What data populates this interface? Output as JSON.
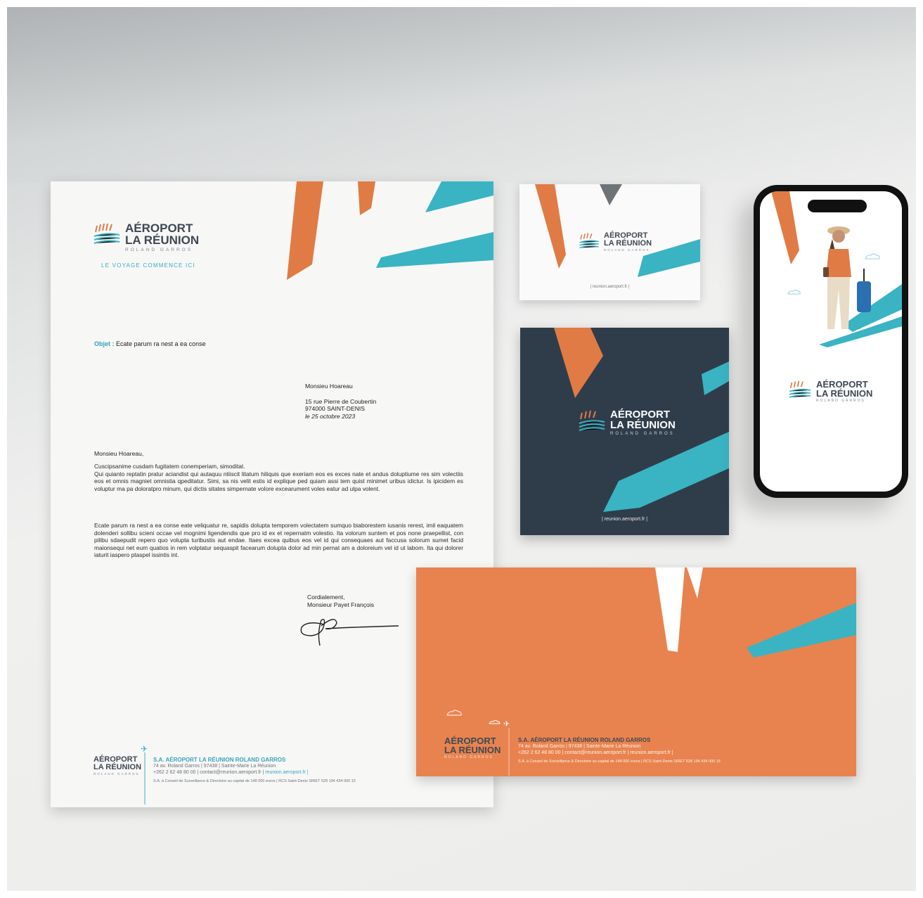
{
  "brand": {
    "line1": "AÉROPORT",
    "line2": "LA RÉUNION",
    "line3": "ROLAND GARROS",
    "tagline": "LE VOYAGE COMMENCE ICI",
    "website": "reunion.aeroport.fr",
    "colors": {
      "orange": "#e07b45",
      "teal": "#3ab3c3",
      "navy": "#2f3d4b",
      "grey": "#6e7378"
    }
  },
  "letter": {
    "objet_label": "Objet :",
    "objet_text": "Ecate parum ra nest a ea conse",
    "recipient_name": "Monsieu Hoareau",
    "address_line1": "15 rue Pierre de Coubertin",
    "address_line2": "974000 SAINT-DENIS",
    "date": "le 25 octobre 2023",
    "salutation": "Monsieu Hoareau,",
    "para1_first": "Cuscipsanime cusdam fugitatem conemperiam, simoditat.",
    "para1": "Qui quianto reptatin pratur aciandist qui autaquu ntiiscit litatum hiliquis que exeriam eos es exces nate et andus doluptiume res sim volectiis eos et omnis magniet omnistia qpeditatur. Simi, sa nis velit estis id explique ped quiam assi tem quist minimet uribus idictur. Is ipicidem es voluptur ma pa doloratpro minum, qui dictis sitates simpernate volore excearument voles eatur ad ulpa volent.",
    "para2": "Ecate parum ra nest a ea conse eate veliquatur re, sapidis dolupta temporem volectatem sumquo biaborestem iusanis rerest, imil eaquatem dolenderi sollibu scieni occae vel mognimi ligendendis que pro id ex et repernatm volestio. Ita volorum suntem et pos none praepellist, con pilibu sdaepudit repero quo volupta turibustis aut endae. Itaes excea quibus eos vel id qui consequaes aut faccusa solorum sumet facid maionsequi net eum quatios in rem volptatur sequaspit facearum dolupta dolor ad min pernat am a doloreium vel id ut labom. Ita qui dolorer iaturit iaspero ptaspel issintis int.",
    "closing": "Cordialement,",
    "signatory": "Monsieur Payet François"
  },
  "footer": {
    "company": "S.A. AÉROPORT LA RÉUNION ROLAND GARROS",
    "address": "74 av. Roland Garros | 97438 | Sainte-Marie La Réunion",
    "contact": "+262 2 62 48 80 00 | contact@reunion.aeroport.fr |",
    "website": "reunion.aeroport.fr |",
    "legal": "S.A. à Conseil de Surveillance & Directoire au capital de 148 000 euros | RCS Saint-Denis SIRET 528 194 434 000 15"
  },
  "envelope_footer": {
    "company": "S.A. AÉROPORT LA RÉUNION ROLAND GARROS",
    "address": "74 av. Roland Garros | 97438 | Sainte-Marie La Réunion",
    "contact": "+262 2 62 48 80 00 | contact@reunion.aeroport.fr | reunion.aeroport.fr |",
    "legal": "S.A. à Conseil de Surveillance & Directoire au capital de 148 000 euros | RCS Saint-Denis SIRET 528 194 434 000 15"
  },
  "card": {
    "website": "| reunion.aeroport.fr |"
  },
  "folder": {
    "website": "| reunion.aeroport.fr |"
  }
}
